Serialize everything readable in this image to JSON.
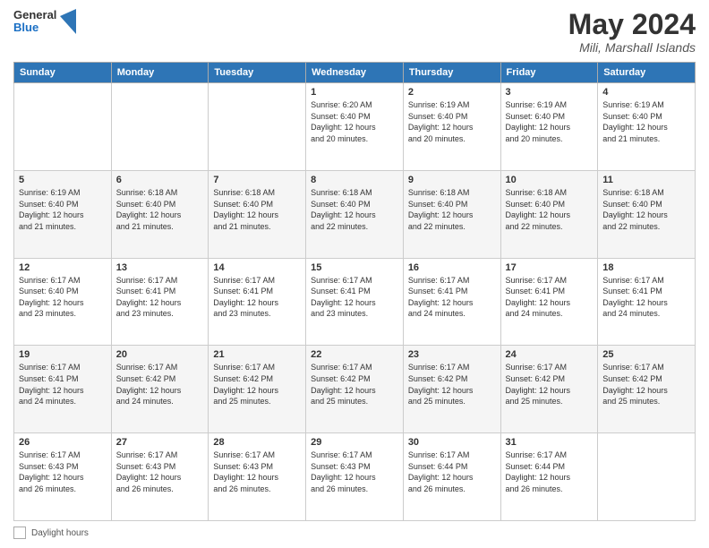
{
  "header": {
    "logo_general": "General",
    "logo_blue": "Blue",
    "title": "May 2024",
    "location": "Mili, Marshall Islands"
  },
  "days_of_week": [
    "Sunday",
    "Monday",
    "Tuesday",
    "Wednesday",
    "Thursday",
    "Friday",
    "Saturday"
  ],
  "weeks": [
    [
      {
        "day": "",
        "info": ""
      },
      {
        "day": "",
        "info": ""
      },
      {
        "day": "",
        "info": ""
      },
      {
        "day": "1",
        "info": "Sunrise: 6:20 AM\nSunset: 6:40 PM\nDaylight: 12 hours\nand 20 minutes."
      },
      {
        "day": "2",
        "info": "Sunrise: 6:19 AM\nSunset: 6:40 PM\nDaylight: 12 hours\nand 20 minutes."
      },
      {
        "day": "3",
        "info": "Sunrise: 6:19 AM\nSunset: 6:40 PM\nDaylight: 12 hours\nand 20 minutes."
      },
      {
        "day": "4",
        "info": "Sunrise: 6:19 AM\nSunset: 6:40 PM\nDaylight: 12 hours\nand 21 minutes."
      }
    ],
    [
      {
        "day": "5",
        "info": "Sunrise: 6:19 AM\nSunset: 6:40 PM\nDaylight: 12 hours\nand 21 minutes."
      },
      {
        "day": "6",
        "info": "Sunrise: 6:18 AM\nSunset: 6:40 PM\nDaylight: 12 hours\nand 21 minutes."
      },
      {
        "day": "7",
        "info": "Sunrise: 6:18 AM\nSunset: 6:40 PM\nDaylight: 12 hours\nand 21 minutes."
      },
      {
        "day": "8",
        "info": "Sunrise: 6:18 AM\nSunset: 6:40 PM\nDaylight: 12 hours\nand 22 minutes."
      },
      {
        "day": "9",
        "info": "Sunrise: 6:18 AM\nSunset: 6:40 PM\nDaylight: 12 hours\nand 22 minutes."
      },
      {
        "day": "10",
        "info": "Sunrise: 6:18 AM\nSunset: 6:40 PM\nDaylight: 12 hours\nand 22 minutes."
      },
      {
        "day": "11",
        "info": "Sunrise: 6:18 AM\nSunset: 6:40 PM\nDaylight: 12 hours\nand 22 minutes."
      }
    ],
    [
      {
        "day": "12",
        "info": "Sunrise: 6:17 AM\nSunset: 6:40 PM\nDaylight: 12 hours\nand 23 minutes."
      },
      {
        "day": "13",
        "info": "Sunrise: 6:17 AM\nSunset: 6:41 PM\nDaylight: 12 hours\nand 23 minutes."
      },
      {
        "day": "14",
        "info": "Sunrise: 6:17 AM\nSunset: 6:41 PM\nDaylight: 12 hours\nand 23 minutes."
      },
      {
        "day": "15",
        "info": "Sunrise: 6:17 AM\nSunset: 6:41 PM\nDaylight: 12 hours\nand 23 minutes."
      },
      {
        "day": "16",
        "info": "Sunrise: 6:17 AM\nSunset: 6:41 PM\nDaylight: 12 hours\nand 24 minutes."
      },
      {
        "day": "17",
        "info": "Sunrise: 6:17 AM\nSunset: 6:41 PM\nDaylight: 12 hours\nand 24 minutes."
      },
      {
        "day": "18",
        "info": "Sunrise: 6:17 AM\nSunset: 6:41 PM\nDaylight: 12 hours\nand 24 minutes."
      }
    ],
    [
      {
        "day": "19",
        "info": "Sunrise: 6:17 AM\nSunset: 6:41 PM\nDaylight: 12 hours\nand 24 minutes."
      },
      {
        "day": "20",
        "info": "Sunrise: 6:17 AM\nSunset: 6:42 PM\nDaylight: 12 hours\nand 24 minutes."
      },
      {
        "day": "21",
        "info": "Sunrise: 6:17 AM\nSunset: 6:42 PM\nDaylight: 12 hours\nand 25 minutes."
      },
      {
        "day": "22",
        "info": "Sunrise: 6:17 AM\nSunset: 6:42 PM\nDaylight: 12 hours\nand 25 minutes."
      },
      {
        "day": "23",
        "info": "Sunrise: 6:17 AM\nSunset: 6:42 PM\nDaylight: 12 hours\nand 25 minutes."
      },
      {
        "day": "24",
        "info": "Sunrise: 6:17 AM\nSunset: 6:42 PM\nDaylight: 12 hours\nand 25 minutes."
      },
      {
        "day": "25",
        "info": "Sunrise: 6:17 AM\nSunset: 6:42 PM\nDaylight: 12 hours\nand 25 minutes."
      }
    ],
    [
      {
        "day": "26",
        "info": "Sunrise: 6:17 AM\nSunset: 6:43 PM\nDaylight: 12 hours\nand 26 minutes."
      },
      {
        "day": "27",
        "info": "Sunrise: 6:17 AM\nSunset: 6:43 PM\nDaylight: 12 hours\nand 26 minutes."
      },
      {
        "day": "28",
        "info": "Sunrise: 6:17 AM\nSunset: 6:43 PM\nDaylight: 12 hours\nand 26 minutes."
      },
      {
        "day": "29",
        "info": "Sunrise: 6:17 AM\nSunset: 6:43 PM\nDaylight: 12 hours\nand 26 minutes."
      },
      {
        "day": "30",
        "info": "Sunrise: 6:17 AM\nSunset: 6:44 PM\nDaylight: 12 hours\nand 26 minutes."
      },
      {
        "day": "31",
        "info": "Sunrise: 6:17 AM\nSunset: 6:44 PM\nDaylight: 12 hours\nand 26 minutes."
      },
      {
        "day": "",
        "info": ""
      }
    ]
  ],
  "footer": {
    "daylight_label": "Daylight hours"
  }
}
